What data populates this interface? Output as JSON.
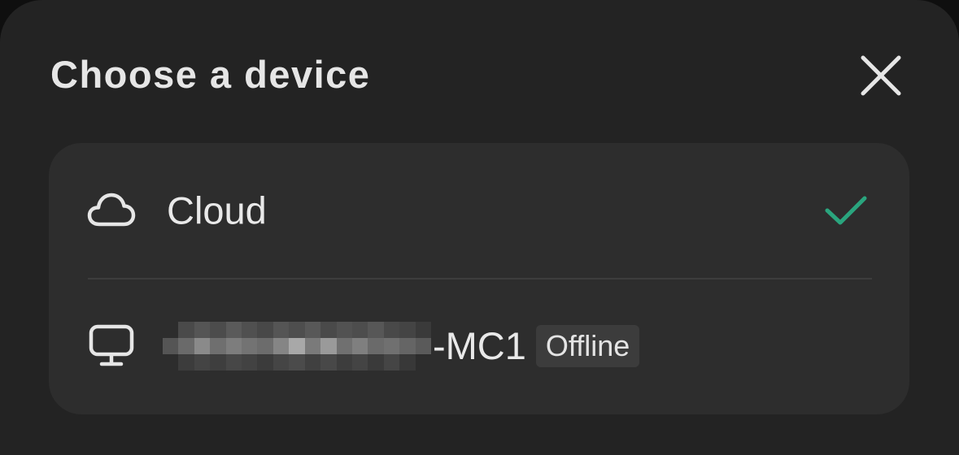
{
  "dialog": {
    "title": "Choose a device",
    "close_icon": "close-icon"
  },
  "options": [
    {
      "icon": "cloud-icon",
      "label": "Cloud",
      "selected": true,
      "check_icon": "checkmark-icon"
    },
    {
      "icon": "monitor-icon",
      "name_redacted": true,
      "name_visible": "-MC1",
      "status_badge": "Offline",
      "selected": false
    }
  ],
  "colors": {
    "background": "#232323",
    "card": "#2d2d2d",
    "text": "#e9e9e9",
    "accent_check": "#2aa57e",
    "badge_bg": "#3c3c3c"
  }
}
